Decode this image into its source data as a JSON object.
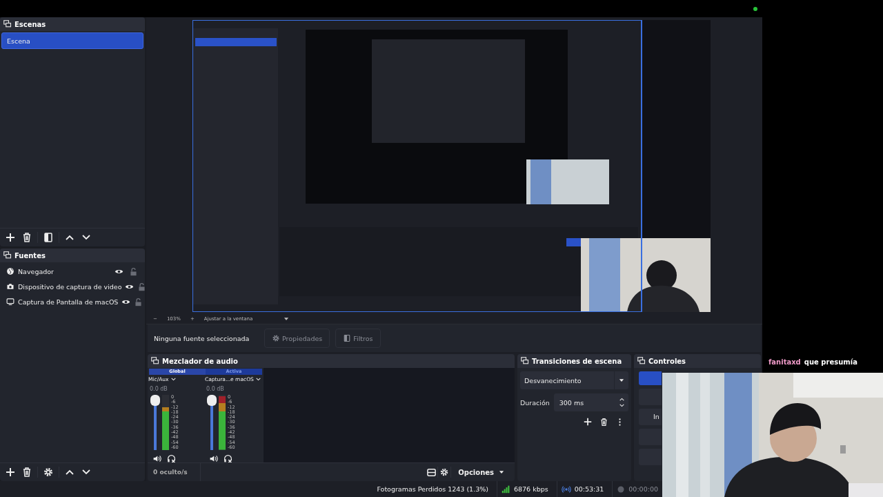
{
  "scenes": {
    "title": "Escenas",
    "items": [
      {
        "label": "Escena",
        "selected": true
      }
    ]
  },
  "sources": {
    "title": "Fuentes",
    "items": [
      {
        "label": "Navegador",
        "kind": "browser",
        "visible": true,
        "locked": false
      },
      {
        "label": "Dispositivo de captura de video",
        "kind": "camera",
        "visible": true,
        "locked": false
      },
      {
        "label": "Captura de Pantalla de macOS",
        "kind": "display",
        "visible": true,
        "locked": false
      }
    ]
  },
  "zoom_bar": {
    "zoom_out": "−",
    "zoom": "103%",
    "zoom_in": "+",
    "fit": "Ajustar a la ventana"
  },
  "context_bar": {
    "status": "Ninguna fuente seleccionada",
    "buttons": [
      {
        "label": "Propiedades",
        "kind": "properties",
        "disabled": true
      },
      {
        "label": "Filtros",
        "kind": "filters",
        "disabled": true
      }
    ]
  },
  "mixer": {
    "title": "Mezclador de audio",
    "tabs": [
      {
        "label": "Global",
        "selected": true
      },
      {
        "label": "Activa",
        "selected": false
      }
    ],
    "channels": [
      {
        "name": "Mic/Aux",
        "volume": "0.0 dB",
        "fader": {
          "level": 1
        },
        "meter": {
          "level": 0.78
        },
        "muted": false,
        "monitor_off": true,
        "scale": [
          "0",
          "-6",
          "-12",
          "-18",
          "-24",
          "-30",
          "-36",
          "-42",
          "-48",
          "-54",
          "-60"
        ]
      },
      {
        "name": "Captura...e macOS",
        "volume": "0.0 dB",
        "fader": {
          "level": 1
        },
        "meter": {
          "level": 0.97
        },
        "muted": false,
        "monitor_off": true,
        "scale": [
          "0",
          "-6",
          "-12",
          "-18",
          "-24",
          "-30",
          "-36",
          "-42",
          "-48",
          "-54",
          "-60"
        ]
      }
    ],
    "hidden": "0 oculto/s",
    "options": "Opciones"
  },
  "transitions": {
    "title": "Transiciones de escena",
    "transition": "Desvanecimiento",
    "duration_label": "Duración",
    "duration": "300 ms"
  },
  "controls": {
    "title": "Controles",
    "buttons": [
      {
        "kind": "primary"
      },
      {
        "kind": "plain"
      },
      {
        "kind": "plain",
        "label": "In"
      },
      {
        "kind": "plain"
      },
      {
        "kind": "plain"
      }
    ]
  },
  "status_bar": {
    "dropped_frames": "Fotogramas Perdidos 1243 (1.3%)",
    "bitrate": "6876 kbps",
    "stream_time": "00:53:31",
    "record_time": "00:00:00"
  },
  "chat_overlay": {
    "user": "fanitaxd",
    "message": "que presumía"
  }
}
